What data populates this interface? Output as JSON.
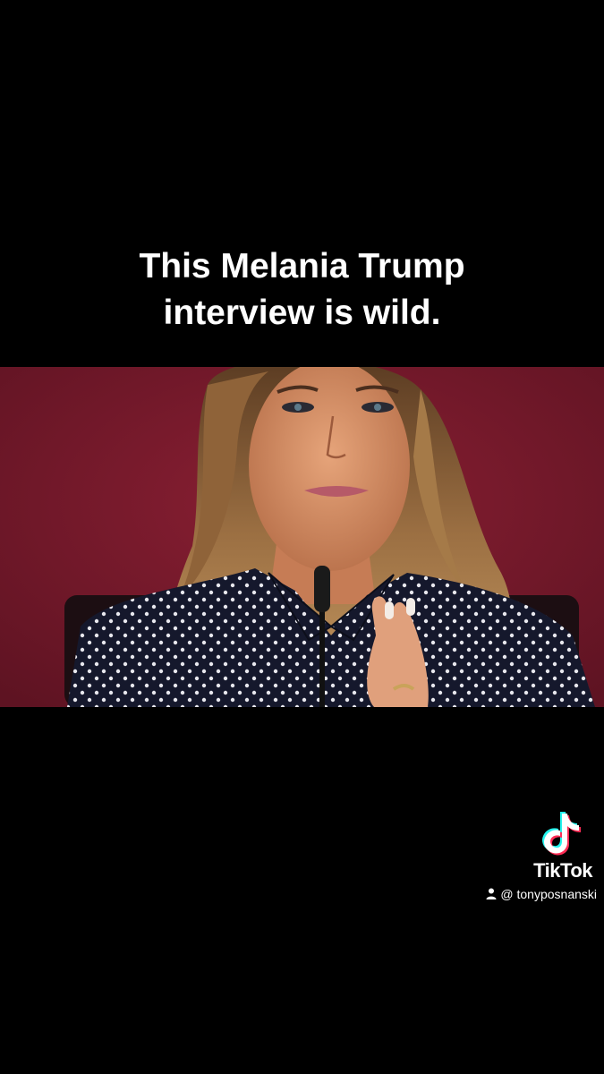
{
  "caption": {
    "line1": "This Melania Trump",
    "line2": "interview is wild."
  },
  "watermark": {
    "brand": "TikTok",
    "handle": "@ tonyposnanski",
    "icon": "tiktok-note-icon",
    "user_icon": "person-icon"
  },
  "colors": {
    "background": "#000000",
    "photo_backdrop": "#7b1a2c",
    "caption_text": "#ffffff",
    "logo_cyan": "#25f4ee",
    "logo_pink": "#fe2c55"
  }
}
